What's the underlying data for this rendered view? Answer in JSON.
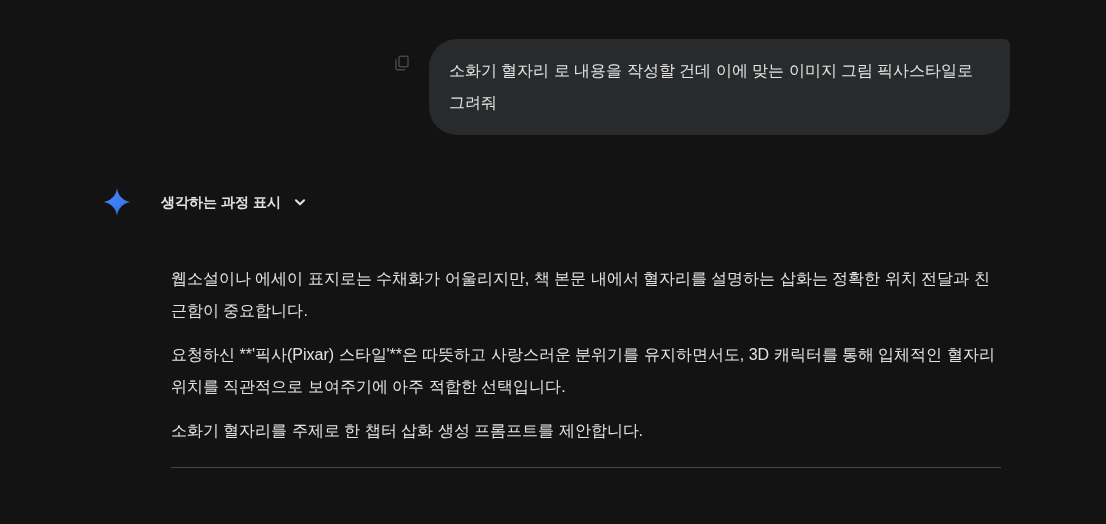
{
  "user_message": {
    "text": "소화기 혈자리 로 내용을 작성할 건데 이에 맞는 이미지 그림 픽사스타일로 그려줘"
  },
  "response": {
    "thinking_toggle": {
      "label": "생각하는 과정 표시",
      "expanded": false
    },
    "paragraphs": [
      "웹소설이나 에세이 표지로는 수채화가 어울리지만, 책 본문 내에서 혈자리를 설명하는 삽화는 정확한 위치 전달과 친근함이 중요합니다.",
      "요청하신 **'픽사(Pixar) 스타일'**은 따뜻하고 사랑스러운 분위기를 유지하면서도, 3D 캐릭터를 통해 입체적인 혈자리 위치를 직관적으로 보여주기에 아주 적합한 선택입니다.",
      "소화기 혈자리를 주제로 한 챕터 삽화 생성 프롬프트를 제안합니다."
    ]
  }
}
